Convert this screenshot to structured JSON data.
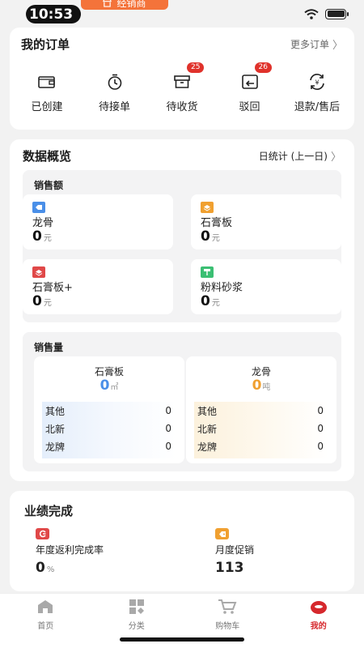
{
  "status": {
    "time": "10:53",
    "pill_text": "经销商"
  },
  "orders": {
    "title": "我的订单",
    "more_label": "更多订单",
    "items": [
      {
        "label": "已创建",
        "icon": "wallet-icon",
        "badge": ""
      },
      {
        "label": "待接单",
        "icon": "timer-icon",
        "badge": ""
      },
      {
        "label": "待收货",
        "icon": "box-icon",
        "badge": "25"
      },
      {
        "label": "驳回",
        "icon": "return-icon",
        "badge": "26"
      },
      {
        "label": "退款/售后",
        "icon": "refund-icon",
        "badge": ""
      }
    ]
  },
  "overview": {
    "title": "数据概览",
    "period_label": "日统计 (上一日)",
    "sales": {
      "title": "销售额",
      "tiles": [
        {
          "name": "龙骨",
          "value": "0",
          "unit": "元",
          "color": "#4a8fe8",
          "icon": "tag-icon"
        },
        {
          "name": "石膏板",
          "value": "0",
          "unit": "元",
          "color": "#f0a030",
          "icon": "layers-icon"
        },
        {
          "name": "石膏板+",
          "value": "0",
          "unit": "元",
          "color": "#e04848",
          "icon": "layers-icon"
        },
        {
          "name": "粉料砂浆",
          "value": "0",
          "unit": "元",
          "color": "#3bbf73",
          "icon": "roller-icon"
        }
      ]
    },
    "volume": {
      "title": "销售量",
      "cards": [
        {
          "name": "石膏板",
          "value": "0",
          "unit": "㎡",
          "value_color": "#4a8fe8",
          "tint": "#e8f1fc",
          "rows": [
            {
              "label": "其他",
              "value": "0"
            },
            {
              "label": "北新",
              "value": "0"
            },
            {
              "label": "龙牌",
              "value": "0"
            }
          ]
        },
        {
          "name": "龙骨",
          "value": "0",
          "unit": "吨",
          "value_color": "#f0a030",
          "tint": "#fdf4e2",
          "rows": [
            {
              "label": "其他",
              "value": "0"
            },
            {
              "label": "北新",
              "value": "0"
            },
            {
              "label": "龙牌",
              "value": "0"
            }
          ]
        }
      ]
    }
  },
  "performance": {
    "title": "业绩完成",
    "items": [
      {
        "label": "年度返利完成率",
        "value": "0",
        "unit": "%",
        "color": "#e04848",
        "icon": "rebate-icon"
      },
      {
        "label": "月度促销",
        "value": "113",
        "unit": "",
        "color": "#f0a030",
        "icon": "promo-tag-icon"
      }
    ]
  },
  "tabbar": {
    "tabs": [
      {
        "label": "首页",
        "icon": "home-icon"
      },
      {
        "label": "分类",
        "icon": "grid-icon"
      },
      {
        "label": "购物车",
        "icon": "cart-icon"
      },
      {
        "label": "我的",
        "icon": "profile-icon"
      }
    ],
    "active_color": "#d6282d"
  }
}
